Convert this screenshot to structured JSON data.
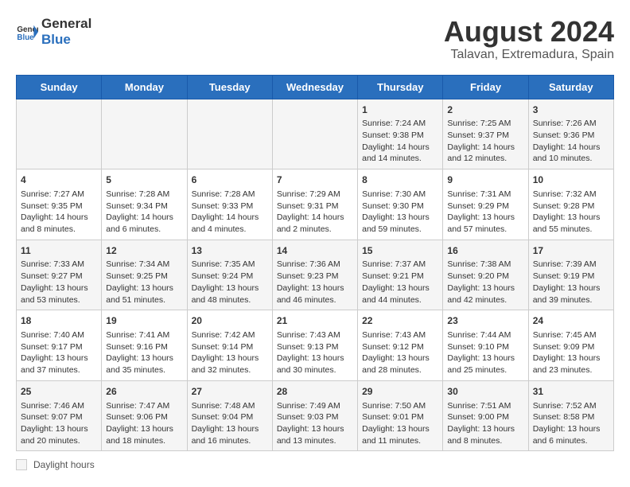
{
  "header": {
    "logo_general": "General",
    "logo_blue": "Blue",
    "main_title": "August 2024",
    "subtitle": "Talavan, Extremadura, Spain"
  },
  "calendar": {
    "days_of_week": [
      "Sunday",
      "Monday",
      "Tuesday",
      "Wednesday",
      "Thursday",
      "Friday",
      "Saturday"
    ],
    "weeks": [
      [
        {
          "day": "",
          "info": ""
        },
        {
          "day": "",
          "info": ""
        },
        {
          "day": "",
          "info": ""
        },
        {
          "day": "",
          "info": ""
        },
        {
          "day": "1",
          "info": "Sunrise: 7:24 AM\nSunset: 9:38 PM\nDaylight: 14 hours and 14 minutes."
        },
        {
          "day": "2",
          "info": "Sunrise: 7:25 AM\nSunset: 9:37 PM\nDaylight: 14 hours and 12 minutes."
        },
        {
          "day": "3",
          "info": "Sunrise: 7:26 AM\nSunset: 9:36 PM\nDaylight: 14 hours and 10 minutes."
        }
      ],
      [
        {
          "day": "4",
          "info": "Sunrise: 7:27 AM\nSunset: 9:35 PM\nDaylight: 14 hours and 8 minutes."
        },
        {
          "day": "5",
          "info": "Sunrise: 7:28 AM\nSunset: 9:34 PM\nDaylight: 14 hours and 6 minutes."
        },
        {
          "day": "6",
          "info": "Sunrise: 7:28 AM\nSunset: 9:33 PM\nDaylight: 14 hours and 4 minutes."
        },
        {
          "day": "7",
          "info": "Sunrise: 7:29 AM\nSunset: 9:31 PM\nDaylight: 14 hours and 2 minutes."
        },
        {
          "day": "8",
          "info": "Sunrise: 7:30 AM\nSunset: 9:30 PM\nDaylight: 13 hours and 59 minutes."
        },
        {
          "day": "9",
          "info": "Sunrise: 7:31 AM\nSunset: 9:29 PM\nDaylight: 13 hours and 57 minutes."
        },
        {
          "day": "10",
          "info": "Sunrise: 7:32 AM\nSunset: 9:28 PM\nDaylight: 13 hours and 55 minutes."
        }
      ],
      [
        {
          "day": "11",
          "info": "Sunrise: 7:33 AM\nSunset: 9:27 PM\nDaylight: 13 hours and 53 minutes."
        },
        {
          "day": "12",
          "info": "Sunrise: 7:34 AM\nSunset: 9:25 PM\nDaylight: 13 hours and 51 minutes."
        },
        {
          "day": "13",
          "info": "Sunrise: 7:35 AM\nSunset: 9:24 PM\nDaylight: 13 hours and 48 minutes."
        },
        {
          "day": "14",
          "info": "Sunrise: 7:36 AM\nSunset: 9:23 PM\nDaylight: 13 hours and 46 minutes."
        },
        {
          "day": "15",
          "info": "Sunrise: 7:37 AM\nSunset: 9:21 PM\nDaylight: 13 hours and 44 minutes."
        },
        {
          "day": "16",
          "info": "Sunrise: 7:38 AM\nSunset: 9:20 PM\nDaylight: 13 hours and 42 minutes."
        },
        {
          "day": "17",
          "info": "Sunrise: 7:39 AM\nSunset: 9:19 PM\nDaylight: 13 hours and 39 minutes."
        }
      ],
      [
        {
          "day": "18",
          "info": "Sunrise: 7:40 AM\nSunset: 9:17 PM\nDaylight: 13 hours and 37 minutes."
        },
        {
          "day": "19",
          "info": "Sunrise: 7:41 AM\nSunset: 9:16 PM\nDaylight: 13 hours and 35 minutes."
        },
        {
          "day": "20",
          "info": "Sunrise: 7:42 AM\nSunset: 9:14 PM\nDaylight: 13 hours and 32 minutes."
        },
        {
          "day": "21",
          "info": "Sunrise: 7:43 AM\nSunset: 9:13 PM\nDaylight: 13 hours and 30 minutes."
        },
        {
          "day": "22",
          "info": "Sunrise: 7:43 AM\nSunset: 9:12 PM\nDaylight: 13 hours and 28 minutes."
        },
        {
          "day": "23",
          "info": "Sunrise: 7:44 AM\nSunset: 9:10 PM\nDaylight: 13 hours and 25 minutes."
        },
        {
          "day": "24",
          "info": "Sunrise: 7:45 AM\nSunset: 9:09 PM\nDaylight: 13 hours and 23 minutes."
        }
      ],
      [
        {
          "day": "25",
          "info": "Sunrise: 7:46 AM\nSunset: 9:07 PM\nDaylight: 13 hours and 20 minutes."
        },
        {
          "day": "26",
          "info": "Sunrise: 7:47 AM\nSunset: 9:06 PM\nDaylight: 13 hours and 18 minutes."
        },
        {
          "day": "27",
          "info": "Sunrise: 7:48 AM\nSunset: 9:04 PM\nDaylight: 13 hours and 16 minutes."
        },
        {
          "day": "28",
          "info": "Sunrise: 7:49 AM\nSunset: 9:03 PM\nDaylight: 13 hours and 13 minutes."
        },
        {
          "day": "29",
          "info": "Sunrise: 7:50 AM\nSunset: 9:01 PM\nDaylight: 13 hours and 11 minutes."
        },
        {
          "day": "30",
          "info": "Sunrise: 7:51 AM\nSunset: 9:00 PM\nDaylight: 13 hours and 8 minutes."
        },
        {
          "day": "31",
          "info": "Sunrise: 7:52 AM\nSunset: 8:58 PM\nDaylight: 13 hours and 6 minutes."
        }
      ]
    ]
  },
  "footer": {
    "daylight_label": "Daylight hours"
  }
}
